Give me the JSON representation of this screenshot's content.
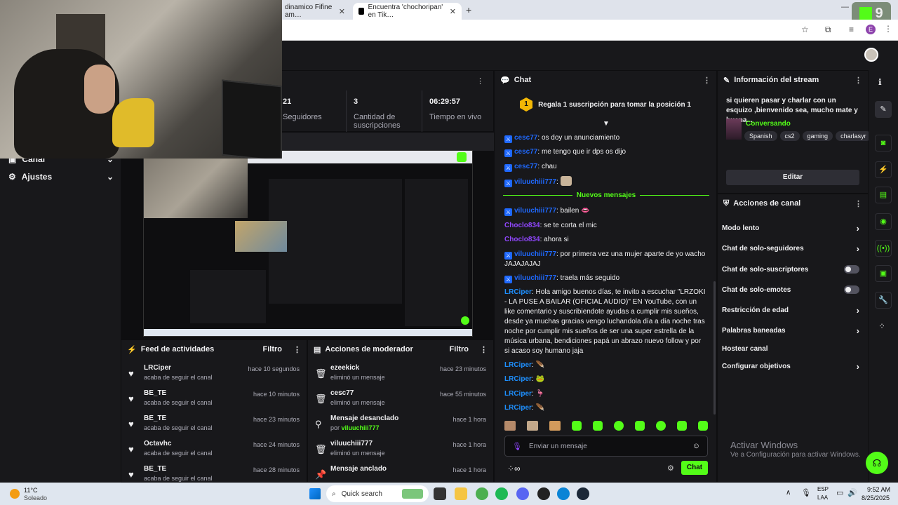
{
  "browser": {
    "tabs": [
      {
        "title": "dinamico Fifine am…"
      },
      {
        "title": "Encuentra 'chochoripan' en Tik…"
      }
    ],
    "new_tab": "+",
    "brand": "9"
  },
  "sidebar": {
    "channel": "Canal",
    "settings": "Ajustes"
  },
  "stats": {
    "followers_label": "Seguidores",
    "followers_value": "21",
    "subs_value": "3",
    "subs_label": "Cantidad de suscripciones",
    "time_value": "06:29:57",
    "time_label": "Tiempo en vivo"
  },
  "activity": {
    "title": "Feed de actividades",
    "filter": "Filtro",
    "items": [
      {
        "name": "LRCiper",
        "sub": "acaba de seguir el canal",
        "time": "hace 10 segundos"
      },
      {
        "name": "BE_TE",
        "sub": "acaba de seguir el canal",
        "time": "hace 10 minutos"
      },
      {
        "name": "BE_TE",
        "sub": "acaba de seguir el canal",
        "time": "hace 23 minutos"
      },
      {
        "name": "Octavhc",
        "sub": "acaba de seguir el canal",
        "time": "hace 24 minutos"
      },
      {
        "name": "BE_TE",
        "sub": "acaba de seguir el canal",
        "time": "hace 28 minutos"
      }
    ]
  },
  "mod": {
    "title": "Acciones de moderador",
    "filter": "Filtro",
    "items": [
      {
        "name": "ezeekick",
        "sub": "eliminó un mensaje",
        "time": "hace 23 minutos"
      },
      {
        "name": "cesc77",
        "sub": "eliminó un mensaje",
        "time": "hace 55 minutos"
      },
      {
        "name": "Mensaje desanclado",
        "sub_prefix": "por ",
        "sub_user": "viluuchiii777",
        "time": "hace 1 hora"
      },
      {
        "name": "viluuchiii777",
        "sub": "eliminó un mensaje",
        "time": "hace 1 hora"
      },
      {
        "name": "Mensaje anclado",
        "sub": "",
        "time": "hace 1 hora"
      }
    ]
  },
  "chat": {
    "title": "Chat",
    "gift_count": "1",
    "gift_text": "Regala 1 suscripción para tomar la posición 1",
    "new_msgs": "Nuevos mensajes",
    "messages": [
      {
        "user": "cesc77",
        "text": "os doy un anunciamiento"
      },
      {
        "user": "cesc77",
        "text": "me tengo que ir dps os dijo"
      },
      {
        "user": "cesc77",
        "text": "chau"
      },
      {
        "user": "viluuchiii777",
        "text": ""
      },
      {
        "user": "viluuchiii777",
        "text": "bailen"
      },
      {
        "user": "Choclo834",
        "text": "se te corta el mic"
      },
      {
        "user": "Choclo834",
        "text": "ahora si"
      },
      {
        "user": "viluuchiii777",
        "text": "por primera vez una mujer aparte de yo wacho JAJAJAJAJ"
      },
      {
        "user": "viluuchiii777",
        "text": "traela más seguido"
      },
      {
        "user": "LRCiper",
        "text": "Hola amigo buenos días, te invito a escuchar \"LRZOKI - LA PUSE A BAILAR (OFICIAL AUDIO)\" EN YouTube, con un like comentario y suscribiendote ayudas a cumplir mis sueños, desde ya muchas gracias vengo luchandola día a día noche tras noche por cumplir mis sueños de ser una super estrella de la música urbana, bendiciones papá un abrazo nuevo follow y por si acaso soy humano jaja"
      },
      {
        "user": "LRCiper",
        "text": ""
      },
      {
        "user": "LRCiper",
        "text": ""
      },
      {
        "user": "LRCiper",
        "text": ""
      },
      {
        "user": "LRCiper",
        "text": ""
      }
    ],
    "placeholder": "Enviar un mensaje",
    "send": "Chat"
  },
  "info": {
    "title": "Información del stream",
    "description": "si quieren pasar y charlar con un esquizo ,bienvenido sea, mucho mate y buena...",
    "category": "Conversando",
    "tags": [
      "Spanish",
      "cs2",
      "gaming",
      "charlasyr"
    ],
    "edit": "Editar"
  },
  "actions": {
    "title": "Acciones de canal",
    "items": [
      {
        "label": "Modo lento",
        "control": "chevron"
      },
      {
        "label": "Chat de solo-seguidores",
        "control": "chevron"
      },
      {
        "label": "Chat de solo-suscriptores",
        "control": "toggle"
      },
      {
        "label": "Chat de solo-emotes",
        "control": "toggle"
      },
      {
        "label": "Restricción de edad",
        "control": "chevron"
      },
      {
        "label": "Palabras baneadas",
        "control": "chevron"
      },
      {
        "label": "Hostear canal",
        "control": "none"
      },
      {
        "label": "Configurar objetivos",
        "control": "chevron"
      }
    ]
  },
  "watermark": {
    "line1": "Activar Windows",
    "line2": "Ve a Configuración para activar Windows."
  },
  "taskbar": {
    "temp": "11°C",
    "weather": "Soleado",
    "search": "Quick search",
    "lang1": "ESP",
    "lang2": "LAA",
    "time": "9:52 AM",
    "date": "8/25/2025"
  },
  "colors": {
    "accent": "#53fc18",
    "panel": "#18181b",
    "bg": "#0e0e10"
  }
}
